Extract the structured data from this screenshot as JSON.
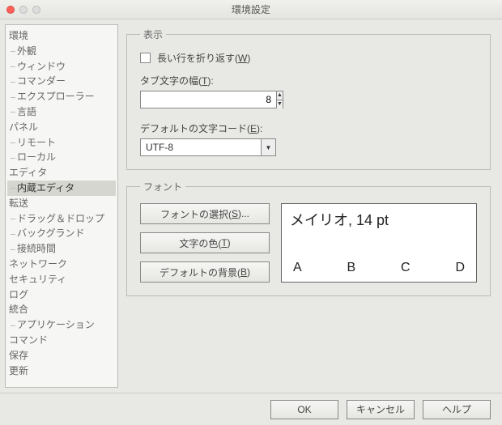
{
  "window": {
    "title": "環境設定"
  },
  "sidebar": {
    "items": [
      {
        "label": "環境",
        "level": 0
      },
      {
        "label": "外観",
        "level": 1
      },
      {
        "label": "ウィンドウ",
        "level": 1
      },
      {
        "label": "コマンダー",
        "level": 1
      },
      {
        "label": "エクスプローラー",
        "level": 1
      },
      {
        "label": "言語",
        "level": 1
      },
      {
        "label": "パネル",
        "level": 0
      },
      {
        "label": "リモート",
        "level": 1
      },
      {
        "label": "ローカル",
        "level": 1
      },
      {
        "label": "エディタ",
        "level": 0
      },
      {
        "label": "内蔵エディタ",
        "level": 1,
        "selected": true
      },
      {
        "label": "転送",
        "level": 0
      },
      {
        "label": "ドラッグ＆ドロップ",
        "level": 1
      },
      {
        "label": "バックグランド",
        "level": 1
      },
      {
        "label": "接続時間",
        "level": 1
      },
      {
        "label": "ネットワーク",
        "level": 0
      },
      {
        "label": "セキュリティ",
        "level": 0
      },
      {
        "label": "ログ",
        "level": 0
      },
      {
        "label": "統合",
        "level": 0
      },
      {
        "label": "アプリケーション",
        "level": 1
      },
      {
        "label": "コマンド",
        "level": 0
      },
      {
        "label": "保存",
        "level": 0
      },
      {
        "label": "更新",
        "level": 0
      }
    ]
  },
  "display_group": {
    "legend": "表示",
    "wrap_label_pre": "長い行を折り返す(",
    "wrap_accel": "W",
    "wrap_label_post": ")",
    "tab_label_pre": "タブ文字の幅(",
    "tab_accel": "T",
    "tab_label_post": "):",
    "tab_value": "8",
    "enc_label_pre": "デフォルトの文字コード(",
    "enc_accel": "E",
    "enc_label_post": "):",
    "enc_value": "UTF-8"
  },
  "font_group": {
    "legend": "フォント",
    "select_label_pre": "フォントの選択(",
    "select_accel": "S",
    "select_label_post": ")...",
    "color_label_pre": "文字の色(",
    "color_accel": "T",
    "color_label_post": ")",
    "bg_label_pre": "デフォルトの背景(",
    "bg_accel": "B",
    "bg_label_post": ")",
    "preview_name": "メイリオ, 14 pt",
    "preview_samples": [
      "A",
      "B",
      "C",
      "D"
    ]
  },
  "footer": {
    "ok": "OK",
    "cancel": "キャンセル",
    "help": "ヘルプ"
  }
}
